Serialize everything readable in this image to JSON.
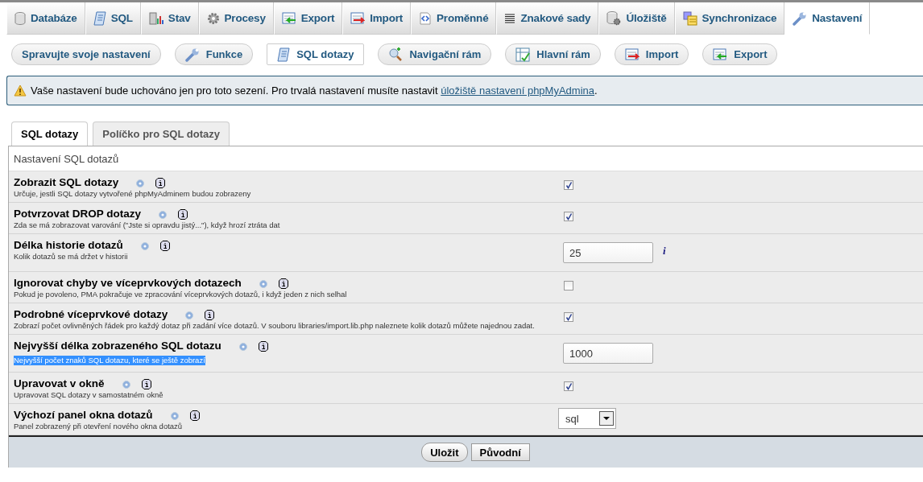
{
  "top_tabs": [
    {
      "label": "Databáze",
      "selected": false
    },
    {
      "label": "SQL",
      "selected": false
    },
    {
      "label": "Stav",
      "selected": false
    },
    {
      "label": "Procesy",
      "selected": false
    },
    {
      "label": "Export",
      "selected": false
    },
    {
      "label": "Import",
      "selected": false
    },
    {
      "label": "Proměnné",
      "selected": false
    },
    {
      "label": "Znakové sady",
      "selected": false
    },
    {
      "label": "Úložiště",
      "selected": false
    },
    {
      "label": "Synchronizace",
      "selected": false
    },
    {
      "label": "Nastavení",
      "selected": true
    }
  ],
  "sub_tabs": [
    {
      "label": "Spravujte svoje nastavení",
      "selected": false
    },
    {
      "label": "Funkce",
      "selected": false
    },
    {
      "label": "SQL dotazy",
      "selected": true
    },
    {
      "label": "Navigační rám",
      "selected": false
    },
    {
      "label": "Hlavní rám",
      "selected": false
    },
    {
      "label": "Import",
      "selected": false
    },
    {
      "label": "Export",
      "selected": false
    }
  ],
  "notice": {
    "text": "Vaše nastavení bude uchováno jen pro toto sezení. Pro trvalá nastavení musíte nastavit ",
    "link": "úložiště nastavení phpMyAdmina",
    "after": "."
  },
  "form_tabs": [
    {
      "label": "SQL dotazy",
      "selected": true
    },
    {
      "label": "Políčko pro SQL dotazy",
      "selected": false
    }
  ],
  "legend": "Nastavení SQL dotazů",
  "settings": [
    {
      "kind": "checkbox",
      "title": "Zobrazit SQL dotazy",
      "description": "Určuje, jestli SQL dotazy vytvořené phpMyAdminem budou zobrazeny",
      "checked": true
    },
    {
      "kind": "checkbox",
      "title": "Potvrzovat DROP dotazy",
      "description": "Zda se má zobrazovat varování (\"Jste si opravdu jistý...\"), když hrozí ztráta dat",
      "checked": true
    },
    {
      "kind": "number",
      "title": "Délka historie dotazů",
      "description": "Kolik dotazů se má držet v historii",
      "value": "25",
      "note": "i"
    },
    {
      "kind": "checkbox",
      "title": "Ignorovat chyby ve víceprvkových dotazech",
      "description": "Pokud je povoleno, PMA pokračuje ve zpracování víceprvkových dotazů, i když jeden z nich selhal",
      "checked": false
    },
    {
      "kind": "checkbox",
      "title": "Podrobné víceprvkové dotazy",
      "description": "Zobrazí počet ovlivněných řádek pro každý dotaz při zadání více dotazů. V souboru libraries/import.lib.php naleznete kolik dotazů můžete najednou zadat.",
      "checked": true
    },
    {
      "kind": "number",
      "title": "Nejvyšší délka zobrazeného SQL dotazu",
      "description": "Nejvyšší počet znaků SQL dotazu, které se ještě zobrazí",
      "value": "1000",
      "highlighted": true
    },
    {
      "kind": "checkbox",
      "title": "Upravovat v okně",
      "description": "Upravovat SQL dotazy v samostatném okně",
      "checked": true
    },
    {
      "kind": "select",
      "title": "Výchozí panel okna dotazů",
      "description": "Panel zobrazený při otevření nového okna dotazů",
      "value": "sql"
    }
  ],
  "buttons": [
    {
      "label": "Uložit",
      "kind": "submit"
    },
    {
      "label": "Původní",
      "kind": "reset"
    }
  ]
}
